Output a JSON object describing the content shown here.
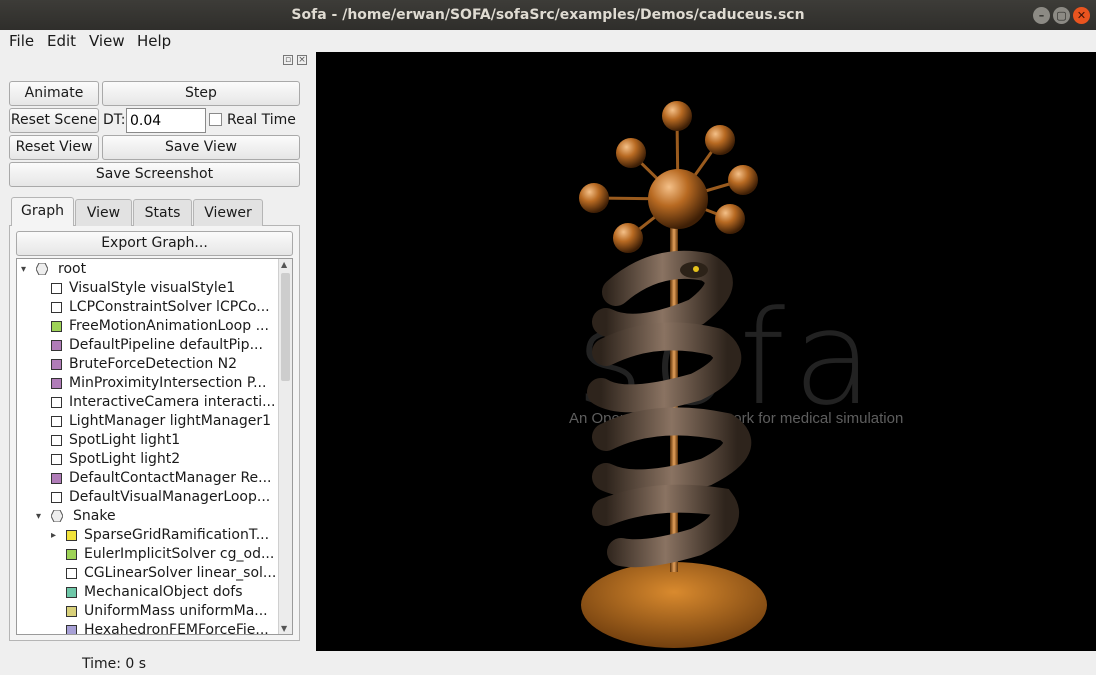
{
  "window": {
    "title": "Sofa - /home/erwan/SOFA/sofaSrc/examples/Demos/caduceus.scn"
  },
  "menu": [
    "File",
    "Edit",
    "View",
    "Help"
  ],
  "controls": {
    "animate": "Animate",
    "step": "Step",
    "reset_scene": "Reset Scene",
    "dt_label": "DT:",
    "dt_value": "0.04",
    "real_time": "Real Time",
    "reset_view": "Reset View",
    "save_view": "Save View",
    "save_screenshot": "Save Screenshot"
  },
  "tabs": [
    "Graph",
    "View",
    "Stats",
    "Viewer"
  ],
  "export_graph": "Export Graph...",
  "tree": [
    {
      "label": "root",
      "icon": "hexagon-node-icon",
      "color": "#ffffff",
      "level": 0,
      "expanded": true
    },
    {
      "label": "VisualStyle visualStyle1",
      "icon": "component-icon",
      "color": "#ffffff",
      "level": 1
    },
    {
      "label": "LCPConstraintSolver lCPCo...",
      "icon": "component-icon",
      "color": "#ffffff",
      "level": 1
    },
    {
      "label": "FreeMotionAnimationLoop ...",
      "icon": "component-icon",
      "color": "#9ed357",
      "level": 1
    },
    {
      "label": "DefaultPipeline defaultPip...",
      "icon": "component-icon",
      "color": "#b07cb8",
      "level": 1
    },
    {
      "label": "BruteForceDetection N2",
      "icon": "component-icon",
      "color": "#b07cb8",
      "level": 1
    },
    {
      "label": "MinProximityIntersection P...",
      "icon": "component-icon",
      "color": "#b07cb8",
      "level": 1
    },
    {
      "label": "InteractiveCamera interacti...",
      "icon": "component-icon",
      "color": "#ffffff",
      "level": 1
    },
    {
      "label": "LightManager lightManager1",
      "icon": "component-icon",
      "color": "#ffffff",
      "level": 1
    },
    {
      "label": "SpotLight light1",
      "icon": "component-icon",
      "color": "#ffffff",
      "level": 1
    },
    {
      "label": "SpotLight light2",
      "icon": "component-icon",
      "color": "#ffffff",
      "level": 1
    },
    {
      "label": "DefaultContactManager Re...",
      "icon": "component-icon",
      "color": "#b07cb8",
      "level": 1
    },
    {
      "label": "DefaultVisualManagerLoop...",
      "icon": "component-icon",
      "color": "#ffffff",
      "level": 1
    },
    {
      "label": "Snake",
      "icon": "hexagon-node-icon",
      "color": "#ffffff",
      "level": 1,
      "expanded": true
    },
    {
      "label": "SparseGridRamificationT...",
      "icon": "component-icon",
      "color": "#f2e33b",
      "level": 2,
      "collapsed": true
    },
    {
      "label": "EulerImplicitSolver cg_od...",
      "icon": "component-icon",
      "color": "#9ed357",
      "level": 2
    },
    {
      "label": "CGLinearSolver linear_sol...",
      "icon": "component-icon",
      "color": "#ffffff",
      "level": 2
    },
    {
      "label": "MechanicalObject dofs",
      "icon": "component-icon",
      "color": "#6ec7a8",
      "level": 2
    },
    {
      "label": "UniformMass uniformMa...",
      "icon": "component-icon",
      "color": "#d8d07a",
      "level": 2
    },
    {
      "label": "HexahedronFEMForceFie...",
      "icon": "component-icon",
      "color": "#a7a0d6",
      "level": 2
    }
  ],
  "status": "Time: 0 s",
  "viewer": {
    "logo_text": "sofa",
    "tagline": "An Open Source framework for medical simulation"
  }
}
